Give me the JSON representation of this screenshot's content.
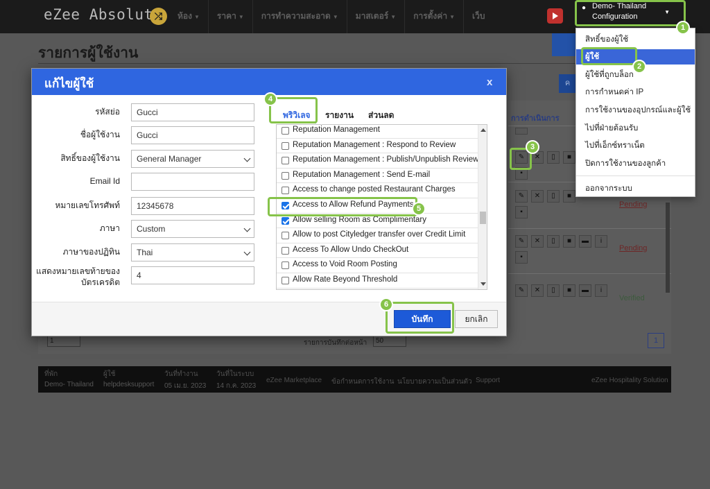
{
  "app": {
    "logo": "eZee Absolute",
    "logo_badge": "⤮"
  },
  "nav": [
    {
      "label": "ห้อง"
    },
    {
      "label": "ราคา"
    },
    {
      "label": "การทำความสะอาด"
    },
    {
      "label": "มาสเตอร์"
    },
    {
      "label": "การตั้งค่า"
    },
    {
      "label": "เว็บ"
    }
  ],
  "user": {
    "line1": "Demo- Thailand",
    "line2": "Configuration"
  },
  "user_menu": [
    {
      "label": "สิทธิ์ของผู้ใช้",
      "active": false
    },
    {
      "label": "ผู้ใช้",
      "active": true
    },
    {
      "label": "ผู้ใช้ที่ถูกบล็อก",
      "active": false
    },
    {
      "label": "การกำหนดค่า IP",
      "active": false
    },
    {
      "label": "การใช้งานของอุปกรณ์และผู้ใช้",
      "active": false
    },
    {
      "label": "ไปที่ฝ่ายต้อนรับ",
      "active": false
    },
    {
      "label": "ไปที่เอ็กซ์ทราเน็ต",
      "active": false
    },
    {
      "label": "ปิดการใช้งานของลูกค้า",
      "active": false
    },
    {
      "label": "ออกจากระบบ",
      "active": false
    }
  ],
  "page": {
    "title": "รายการผู้ใช้งาน",
    "add_button": "ค",
    "actions_header": "การดำเนินการ",
    "statuses": [
      "Pending",
      "Pending",
      "Verified"
    ],
    "records_label": "รายการบันทึกต่อหน้า",
    "records_per_page": "50",
    "page_select": "1",
    "current_page": "1"
  },
  "footer": {
    "property_label": "ที่พัก",
    "property_value": "Demo- Thailand",
    "user_label": "ผู้ใช้",
    "user_value": "helpdesksupport",
    "work_date_label": "วันที่ทำงาน",
    "work_date_value": "05 เม.ย. 2023",
    "system_date_label": "วันที่ในระบบ",
    "system_date_value": "14 ก.ค. 2023",
    "links": [
      "eZee Marketplace",
      "ข้อกำหนดการใช้งาน",
      "นโยบายความเป็นส่วนตัว",
      "Support"
    ],
    "brand": "eZee Hospitality Solution"
  },
  "modal": {
    "title": "แก้ไขผู้ใช้",
    "close": "x",
    "fields": {
      "code_label": "รหัสย่อ",
      "code_value": "Gucci",
      "username_label": "ชื่อผู้ใช้งาน",
      "username_value": "Gucci",
      "privilege_label": "สิทธิ์ของผู้ใช้งาน",
      "privilege_value": "General Manager",
      "email_label": "Email Id",
      "email_value": "",
      "phone_label": "หมายเลขโทรศัพท์",
      "phone_value": "12345678",
      "language_label": "ภาษา",
      "language_value": "Custom",
      "calendar_label": "ภาษาของปฏิทิน",
      "calendar_value": "Thai",
      "card_digits_label_1": "แสดงหมายเลขท้ายของ",
      "card_digits_label_2": "บัตรเครดิต",
      "card_digits_value": "4"
    },
    "tabs": [
      {
        "label": "พริวิเลจ",
        "active": true
      },
      {
        "label": "รายงาน",
        "active": false
      },
      {
        "label": "ส่วนลด",
        "active": false
      }
    ],
    "privileges": [
      {
        "label": "Reputation Management",
        "checked": false
      },
      {
        "label": "Reputation Management : Respond to Review",
        "checked": false
      },
      {
        "label": "Reputation Management : Publish/Unpublish Review",
        "checked": false
      },
      {
        "label": "Reputation Management : Send E-mail",
        "checked": false
      },
      {
        "label": "Access to change posted Restaurant Charges",
        "checked": false
      },
      {
        "label": "Access to Allow Refund Payments",
        "checked": true
      },
      {
        "label": "Allow selling Room as Complimentary",
        "checked": true
      },
      {
        "label": "Allow to post Cityledger transfer over Credit Limit",
        "checked": false
      },
      {
        "label": "Access To Allow Undo CheckOut",
        "checked": false
      },
      {
        "label": "Access to Void Room Posting",
        "checked": false
      },
      {
        "label": "Allow Rate Beyond Threshold",
        "checked": false
      }
    ],
    "save_label": "บันทึก",
    "cancel_label": "ยกเลิก"
  },
  "callouts": [
    "1",
    "2",
    "3",
    "4",
    "5",
    "6"
  ],
  "colors": {
    "accent": "#2f66e0",
    "highlight": "#86c34a",
    "topbar": "#1b1b1b"
  }
}
